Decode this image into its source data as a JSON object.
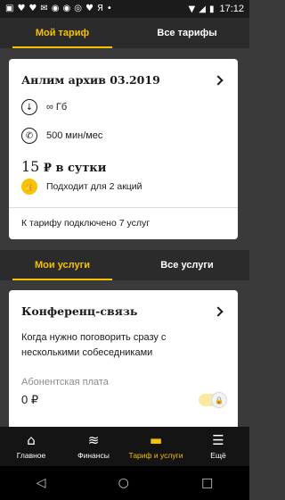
{
  "status_bar": {
    "left_icons": [
      "sim-icon",
      "heart-icon",
      "heart-icon",
      "mail-icon",
      "chrome-icon",
      "chrome-icon",
      "instagram-icon",
      "heart-icon",
      "yandex-icon",
      "dots-icon"
    ],
    "yandex_letter": "Я",
    "time": "17:12"
  },
  "top_tabs": {
    "my_tariff": "Мой тариф",
    "all_tariffs": "Все тарифы"
  },
  "tariff_card": {
    "title": "Анлим архив 03.2019",
    "internet": "∞ Гб",
    "minutes": "500 мин/мес",
    "price_number": "15",
    "price_unit": " ₽ в сутки",
    "promo": "Подходит для 2 акций",
    "services_count": "К тарифу подключено 7 услуг"
  },
  "services_tabs": {
    "my_services": "Мои услуги",
    "all_services": "Все услуги"
  },
  "service_card": {
    "title": "Конференц-связь",
    "description": "Когда нужно поговорить сразу с несколькими собеседниками",
    "fee_label": "Абонентская плата",
    "fee_value": "0 ₽",
    "toggle_enabled": true
  },
  "bottom_nav": {
    "items": [
      {
        "label": "Главное",
        "icon": "home-icon"
      },
      {
        "label": "Финансы",
        "icon": "coins-icon"
      },
      {
        "label": "Тариф и услуги",
        "icon": "sim-card-icon"
      },
      {
        "label": "Ещё",
        "icon": "menu-icon"
      }
    ],
    "active_index": 2
  },
  "colors": {
    "accent": "#f7c200",
    "background": "#3a3a3a",
    "nav_background": "#141414"
  }
}
